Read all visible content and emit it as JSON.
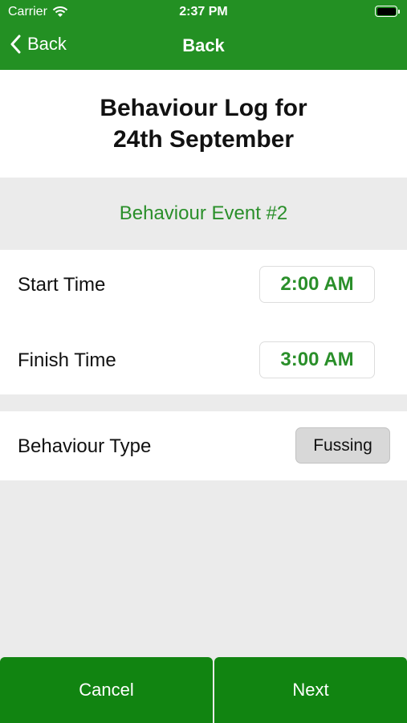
{
  "status_bar": {
    "carrier": "Carrier",
    "time": "2:37 PM"
  },
  "nav": {
    "back_label": "Back",
    "title": "Back"
  },
  "header": {
    "title": "Behaviour Log for 24th September"
  },
  "event": {
    "label": "Behaviour Event #2"
  },
  "times": {
    "start_label": "Start Time",
    "start_value": "2:00 AM",
    "finish_label": "Finish Time",
    "finish_value": "3:00 AM"
  },
  "behaviour": {
    "label": "Behaviour Type",
    "value": "Fussing"
  },
  "actions": {
    "cancel_label": "Cancel",
    "next_label": "Next"
  },
  "colors": {
    "brand_green": "#239023",
    "button_green": "#118411",
    "accent_text": "#2a8f2a"
  }
}
